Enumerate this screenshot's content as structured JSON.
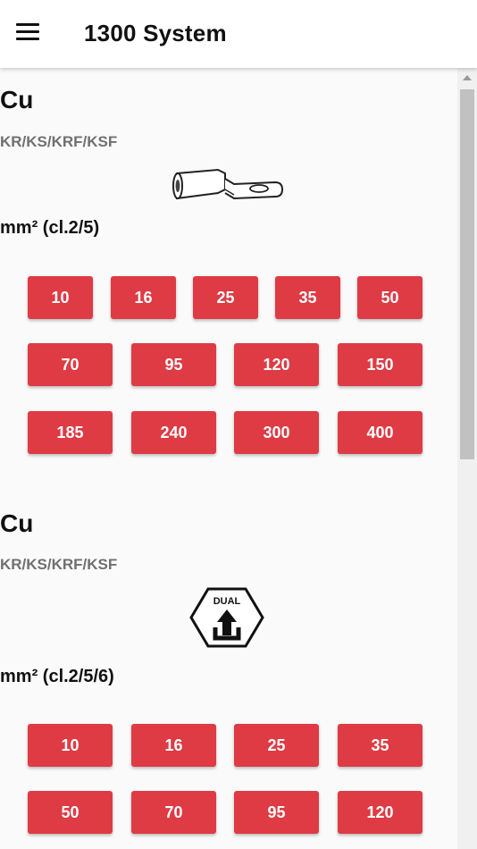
{
  "header": {
    "title": "1300 System",
    "menu_icon": "hamburger-menu-icon"
  },
  "sections": [
    {
      "metal": "Cu",
      "types": "KR/KS/KRF/KSF",
      "icon": "cable-lug-icon",
      "unit": "mm² (cl.2/5)",
      "sizes": [
        "10",
        "16",
        "25",
        "35",
        "50",
        "70",
        "95",
        "120",
        "150",
        "185",
        "240",
        "300",
        "400"
      ]
    },
    {
      "metal": "Cu",
      "types": "KR/KS/KRF/KSF",
      "icon": "dual-badge-icon",
      "badge_text": "DUAL",
      "unit": "mm² (cl.2/5/6)",
      "sizes": [
        "10",
        "16",
        "25",
        "35",
        "50",
        "70",
        "95",
        "120"
      ]
    }
  ],
  "colors": {
    "accent": "#de3b44",
    "muted_text": "#707070"
  }
}
